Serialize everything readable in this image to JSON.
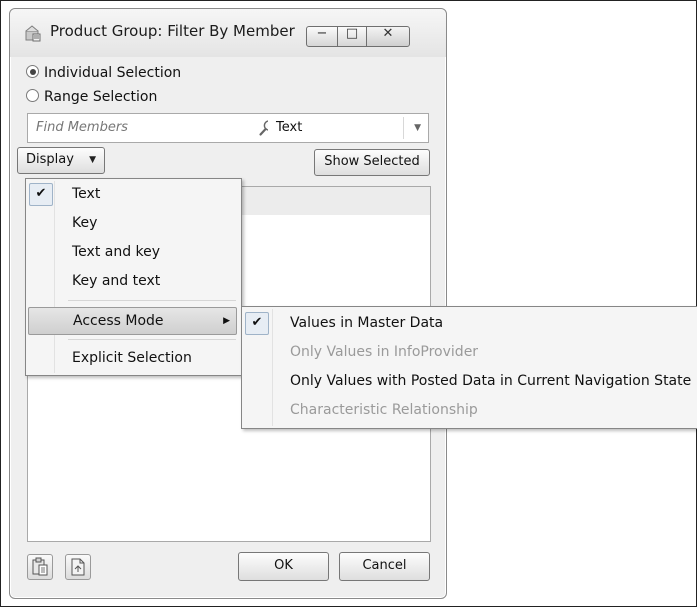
{
  "window": {
    "title": "Product Group: Filter By Member",
    "minimize_glyph": "−",
    "maximize_glyph": "□",
    "close_glyph": "✕"
  },
  "selection_mode": {
    "options": [
      {
        "label": "Individual Selection",
        "selected": true
      },
      {
        "label": "Range Selection",
        "selected": false
      }
    ]
  },
  "search": {
    "placeholder": "Find Members",
    "value": "",
    "icon": "search-icon"
  },
  "display_type_select": {
    "selected": "Text"
  },
  "toolbar": {
    "display_label": "Display",
    "show_selected_label": "Show Selected"
  },
  "display_menu": {
    "items": [
      {
        "label": "Text",
        "checked": true
      },
      {
        "label": "Key",
        "checked": false
      },
      {
        "label": "Text and key",
        "checked": false
      },
      {
        "label": "Key and text",
        "checked": false
      },
      {
        "label": "Access Mode",
        "submenu": true,
        "highlighted": true
      },
      {
        "label": "Explicit Selection",
        "checked": false
      }
    ]
  },
  "access_mode_menu": {
    "items": [
      {
        "label": "Values in Master Data",
        "checked": true,
        "enabled": true
      },
      {
        "label": "Only Values in InfoProvider",
        "checked": false,
        "enabled": false
      },
      {
        "label": "Only Values with Posted Data in Current Navigation State",
        "checked": false,
        "enabled": true
      },
      {
        "label": "Characteristic Relationship",
        "checked": false,
        "enabled": false
      }
    ]
  },
  "footer": {
    "ok_label": "OK",
    "cancel_label": "Cancel"
  },
  "colors": {
    "dialog_bg": "#efefef",
    "menu_bg": "#f5f5f5",
    "disabled_text": "#9a9a9a"
  }
}
